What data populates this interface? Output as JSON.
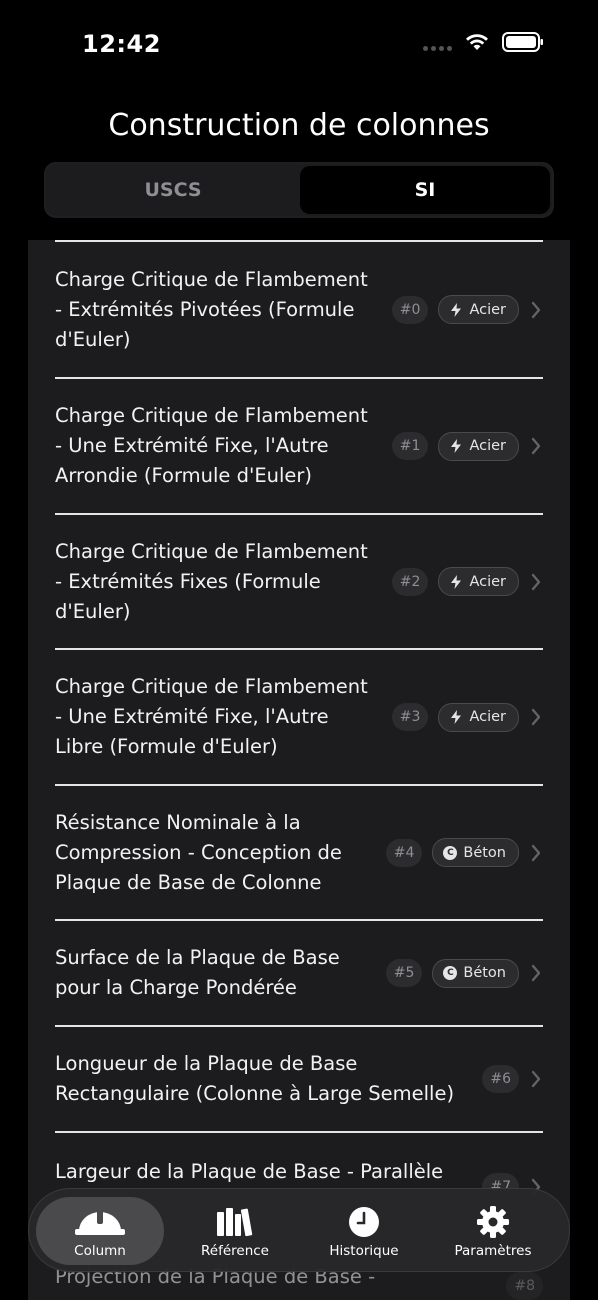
{
  "status_bar": {
    "time": "12:42"
  },
  "nav": {
    "title": "Construction de colonnes"
  },
  "segments": {
    "uscs": "USCS",
    "si": "SI"
  },
  "rows": [
    {
      "title_lines": [
        "Charge Critique de Flambement",
        "- Extrémités Pivotées (Formule",
        "d'Euler)"
      ],
      "index": "#0",
      "tag": "Acier",
      "tag_icon": "bolt-icon"
    },
    {
      "title_lines": [
        "Charge Critique de Flambement",
        "- Une Extrémité Fixe, l'Autre",
        "Arrondie (Formule d'Euler)"
      ],
      "index": "#1",
      "tag": "Acier",
      "tag_icon": "bolt-icon"
    },
    {
      "title_lines": [
        "Charge Critique de Flambement",
        "- Extrémités Fixes (Formule",
        "d'Euler)"
      ],
      "index": "#2",
      "tag": "Acier",
      "tag_icon": "bolt-icon"
    },
    {
      "title_lines": [
        "Charge Critique de Flambement",
        "- Une Extrémité Fixe, l'Autre",
        "Libre (Formule d'Euler)"
      ],
      "index": "#3",
      "tag": "Acier",
      "tag_icon": "bolt-icon"
    },
    {
      "title_lines": [
        "Résistance Nominale à la",
        "Compression - Conception de",
        "Plaque de Base de Colonne"
      ],
      "index": "#4",
      "tag": "Béton",
      "tag_icon": "concrete-c-icon"
    },
    {
      "title_lines": [
        "Surface de la Plaque de Base",
        "pour la Charge Pondérée"
      ],
      "index": "#5",
      "tag": "Béton",
      "tag_icon": "concrete-c-icon"
    },
    {
      "title_lines": [
        "Longueur de la Plaque de Base",
        "Rectangulaire (Colonne à Large Semelle)"
      ],
      "index": "#6"
    },
    {
      "title_lines": [
        "Largeur de la Plaque de Base - Parallèle",
        ""
      ],
      "index": "#7"
    },
    {
      "title_lines": [
        "Projection de la Plaque de Base -",
        ""
      ],
      "index": "#8"
    }
  ],
  "tabbar": {
    "tabs": [
      {
        "label": "Column",
        "icon": "hard-hat-icon",
        "active": true
      },
      {
        "label": "Référence",
        "icon": "books-icon",
        "active": false
      },
      {
        "label": "Historique",
        "icon": "clock-icon",
        "active": false
      },
      {
        "label": "Paramètres",
        "icon": "gear-icon",
        "active": false
      }
    ]
  }
}
